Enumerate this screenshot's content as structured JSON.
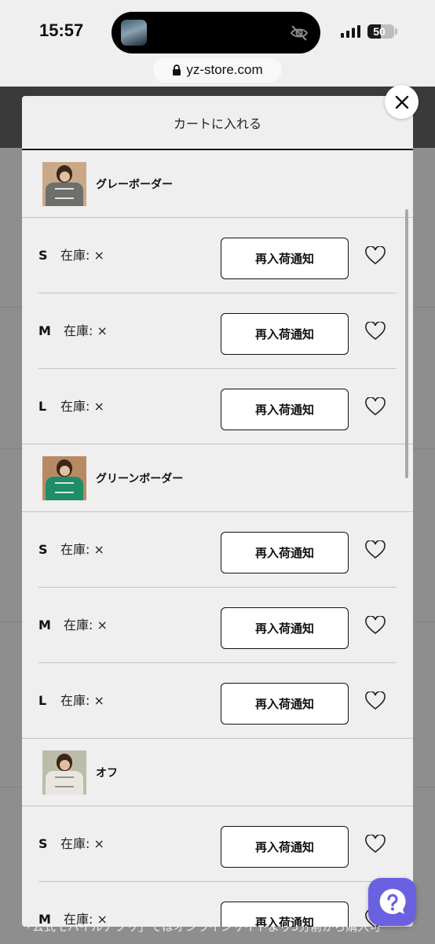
{
  "status_bar": {
    "time": "15:57",
    "battery": "50",
    "battery_level": 0.5
  },
  "browser": {
    "url": "yz-store.com"
  },
  "modal": {
    "title": "カートに入れる",
    "products": [
      {
        "name": "グレーボーダー",
        "shirt_color": "#6e6e6c",
        "sizes": [
          {
            "size": "S",
            "stock": "在庫: ×",
            "button": "再入荷通知"
          },
          {
            "size": "M",
            "stock": "在庫: ×",
            "button": "再入荷通知"
          },
          {
            "size": "L",
            "stock": "在庫: ×",
            "button": "再入荷通知"
          }
        ]
      },
      {
        "name": "グリーンボーダー",
        "shirt_color": "#1f8d6a",
        "sizes": [
          {
            "size": "S",
            "stock": "在庫: ×",
            "button": "再入荷通知"
          },
          {
            "size": "M",
            "stock": "在庫: ×",
            "button": "再入荷通知"
          },
          {
            "size": "L",
            "stock": "在庫: ×",
            "button": "再入荷通知"
          }
        ]
      },
      {
        "name": "オフ",
        "shirt_color": "#e8e6df",
        "sizes": [
          {
            "size": "S",
            "stock": "在庫: ×",
            "button": "再入荷通知"
          },
          {
            "size": "M",
            "stock": "在庫: ×",
            "button": "再入荷通知"
          }
        ]
      }
    ]
  },
  "background": {
    "bottom_text": "「公式モバイルアプリ」ではオンラインサイトより5分前から購入可"
  },
  "icons": {
    "close": "close-icon",
    "favorite": "heart-outline-icon",
    "help": "question-icon"
  },
  "colors": {
    "help_button": "#6a61e0",
    "page_dim": "#8e8e8e"
  }
}
